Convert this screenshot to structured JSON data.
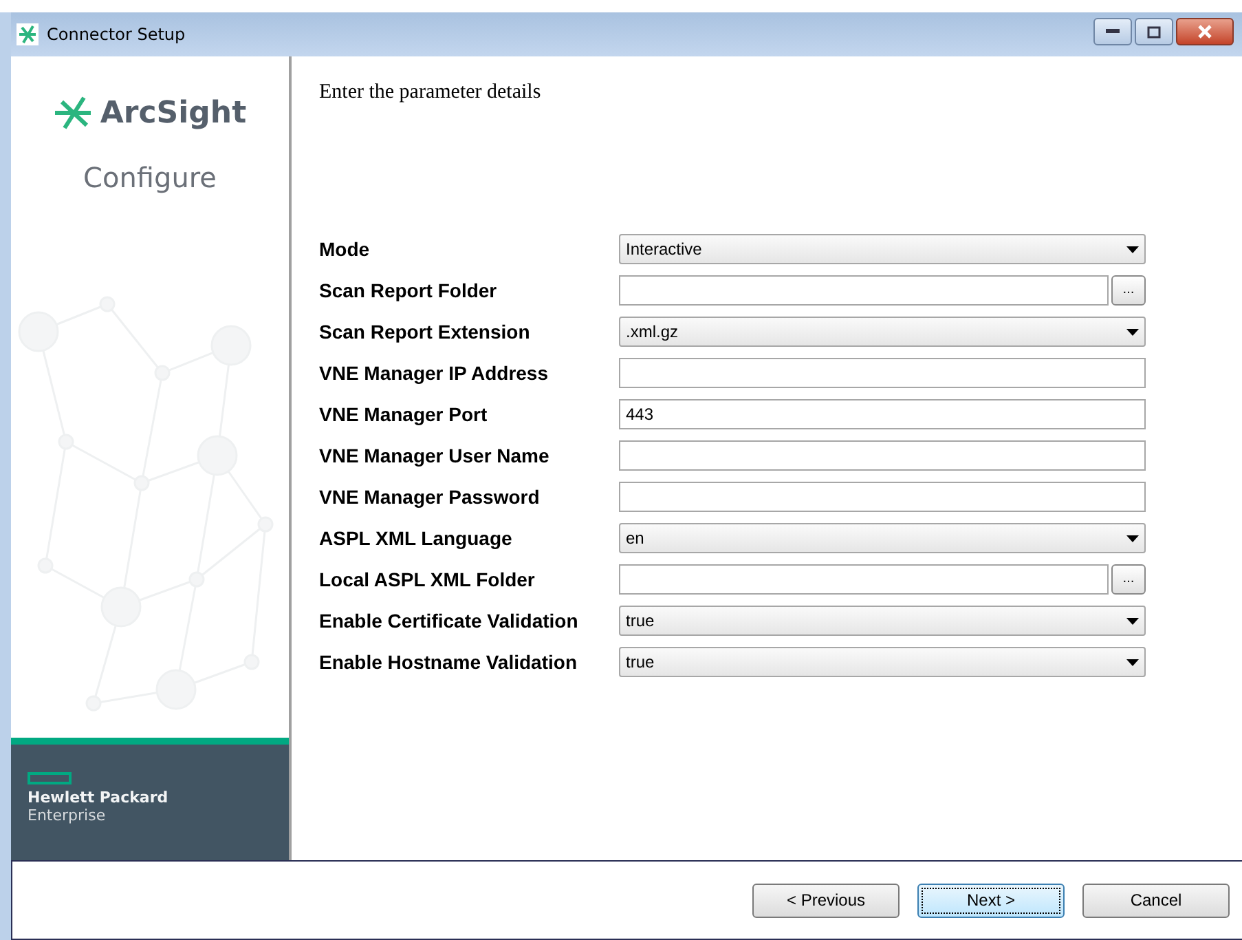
{
  "window": {
    "title": "Connector Setup"
  },
  "sidebar": {
    "logo": "ArcSight",
    "step": "Configure",
    "vendor_line_1": "Hewlett Packard",
    "vendor_line_2": "Enterprise"
  },
  "heading": "Enter the parameter details",
  "fields": [
    {
      "label": "Mode",
      "kind": "dropdown",
      "value": "Interactive"
    },
    {
      "label": "Scan Report Folder",
      "kind": "browse",
      "button": "..."
    },
    {
      "label": "Scan Report Extension",
      "kind": "dropdown",
      "value": ".xml.gz"
    },
    {
      "label": "VNE Manager IP Address",
      "kind": "text"
    },
    {
      "label": "VNE Manager Port",
      "kind": "text",
      "value": "443"
    },
    {
      "label": "VNE Manager User Name",
      "kind": "text"
    },
    {
      "label": "VNE Manager Password",
      "kind": "text"
    },
    {
      "label": "ASPL XML Language",
      "kind": "dropdown",
      "value": "en"
    },
    {
      "label": "Local ASPL XML Folder",
      "kind": "browse",
      "button": "..."
    },
    {
      "label": "Enable Certificate Validation",
      "kind": "dropdown",
      "value": "true"
    },
    {
      "label": "Enable Hostname Validation",
      "kind": "dropdown",
      "value": "true"
    }
  ],
  "buttons": [
    {
      "label": "< Previous",
      "focused": false
    },
    {
      "label": "Next >",
      "focused": true
    },
    {
      "label": "Cancel",
      "focused": false
    }
  ]
}
